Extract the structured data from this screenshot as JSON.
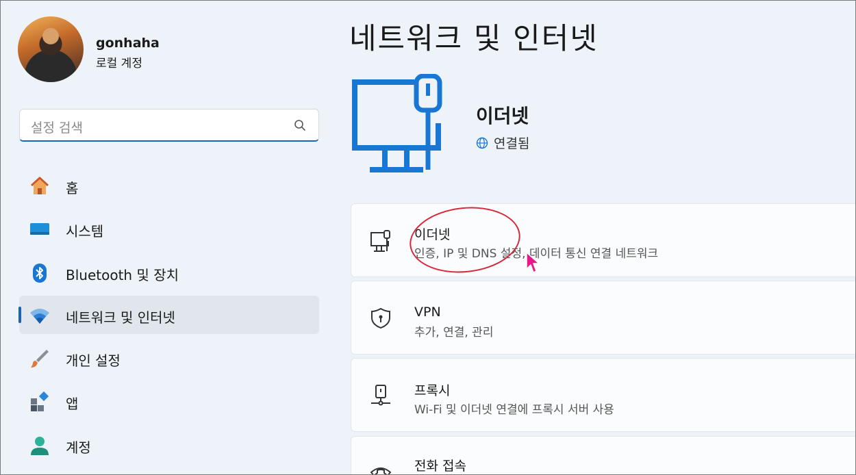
{
  "user": {
    "name": "gonhaha",
    "account_type": "로컬 계정"
  },
  "search": {
    "placeholder": "설정 검색"
  },
  "sidebar": {
    "items": [
      {
        "label": "홈",
        "icon": "home-icon"
      },
      {
        "label": "시스템",
        "icon": "system-icon"
      },
      {
        "label": "Bluetooth 및 장치",
        "icon": "bluetooth-icon"
      },
      {
        "label": "네트워크 및 인터넷",
        "icon": "wifi-icon",
        "selected": true
      },
      {
        "label": "개인 설정",
        "icon": "brush-icon"
      },
      {
        "label": "앱",
        "icon": "apps-icon"
      },
      {
        "label": "계정",
        "icon": "account-icon"
      }
    ]
  },
  "main": {
    "title": "네트워크 및 인터넷",
    "hero": {
      "title": "이더넷",
      "status": "연결됨"
    },
    "cards": [
      {
        "title": "이더넷",
        "subtitle": "인증, IP 및 DNS 설정, 데이터 통신 연결 네트워크",
        "icon": "ethernet-icon"
      },
      {
        "title": "VPN",
        "subtitle": "추가, 연결, 관리",
        "icon": "vpn-shield-icon"
      },
      {
        "title": "프록시",
        "subtitle": "Wi-Fi 및 이더넷 연결에 프록시 서버 사용",
        "icon": "proxy-icon"
      },
      {
        "title": "전화 접속",
        "subtitle": "",
        "icon": "dialup-icon"
      }
    ]
  },
  "colors": {
    "accent": "#1a63b8",
    "annotation": "#d6283a",
    "background": "#eef3f9"
  }
}
